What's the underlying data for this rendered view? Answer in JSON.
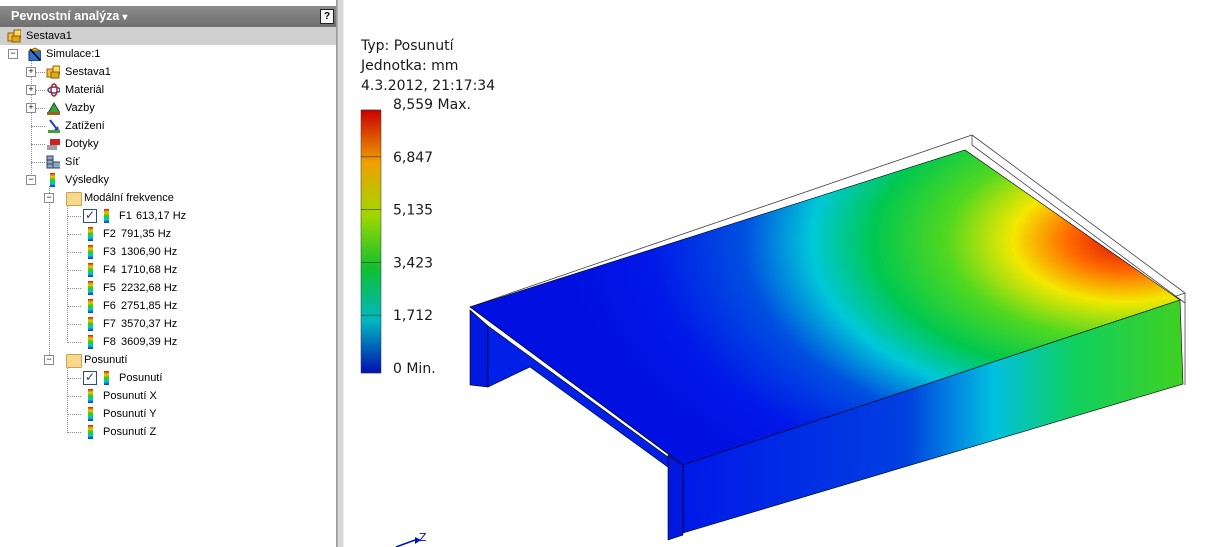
{
  "panel": {
    "title": "Pevnostní analýza",
    "dropdown_glyph": "▾",
    "help_glyph": "?"
  },
  "tree": {
    "root": "Sestava1",
    "simulation": "Simulace:1",
    "items": {
      "sestava": "Sestava1",
      "material": "Materiál",
      "vazby": "Vazby",
      "zatizeni": "Zatížení",
      "dotyky": "Dotyky",
      "sit": "Síť",
      "vysledky": "Výsledky"
    },
    "modal_folder": "Modální frekvence",
    "modal_items": [
      {
        "label": "F1",
        "value": "613,17 Hz",
        "checked": true
      },
      {
        "label": "F2",
        "value": "791,35 Hz",
        "checked": false
      },
      {
        "label": "F3",
        "value": "1306,90 Hz",
        "checked": false
      },
      {
        "label": "F4",
        "value": "1710,68 Hz",
        "checked": false
      },
      {
        "label": "F5",
        "value": "2232,68 Hz",
        "checked": false
      },
      {
        "label": "F6",
        "value": "2751,85 Hz",
        "checked": false
      },
      {
        "label": "F7",
        "value": "3570,37 Hz",
        "checked": false
      },
      {
        "label": "F8",
        "value": "3609,39 Hz",
        "checked": false
      }
    ],
    "displacement_folder": "Posunutí",
    "displacement_items": [
      {
        "label": "Posunutí",
        "checked": true
      },
      {
        "label": "Posunutí X",
        "checked": false
      },
      {
        "label": "Posunutí Y",
        "checked": false
      },
      {
        "label": "Posunutí Z",
        "checked": false
      }
    ]
  },
  "legend": {
    "type_line": "Typ: Posunutí",
    "unit_line": "Jednotka: mm",
    "date_line": "4.3.2012, 21:17:34",
    "ticks": [
      "8,559 Max.",
      "6,847",
      "5,135",
      "3,423",
      "1,712",
      "0 Min."
    ]
  },
  "axis_label": "Z",
  "colors": {
    "header_bg": "#7c7c7c",
    "root_selected_bg": "#cfcfcf",
    "scale_max": "#c80000",
    "scale_min": "#0010b0"
  }
}
